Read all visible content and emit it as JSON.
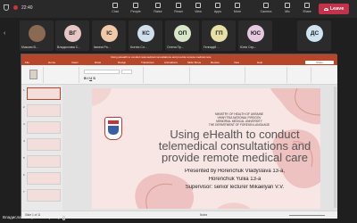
{
  "meeting": {
    "time": "22:40",
    "leave_label": "Leave",
    "toolbar": [
      {
        "label": "Chat",
        "icon": "chat-icon"
      },
      {
        "label": "People",
        "icon": "people-icon"
      },
      {
        "label": "Raise",
        "icon": "raise-hand-icon"
      },
      {
        "label": "React",
        "icon": "react-icon"
      },
      {
        "label": "View",
        "icon": "view-icon"
      },
      {
        "label": "Apps",
        "icon": "apps-icon"
      },
      {
        "label": "More",
        "icon": "more-icon"
      },
      {
        "label": "Camera",
        "icon": "camera-icon"
      },
      {
        "label": "Mic",
        "icon": "mic-icon"
      },
      {
        "label": "Share",
        "icon": "share-icon"
      }
    ]
  },
  "participants": [
    {
      "initials": "",
      "name": "Максим В...",
      "color": "#8a6a50"
    },
    {
      "initials": "ВГ",
      "name": "Владислава С...",
      "color": "#e7c6c6"
    },
    {
      "initials": "ІС",
      "name": "Іванна Ра...",
      "color": "#f0c9a8"
    },
    {
      "initials": "КС",
      "name": "Ксенія Сл...",
      "color": "#cfe0ec"
    },
    {
      "initials": "ОП",
      "name": "Олена Пр...",
      "color": "#d9e7c9"
    },
    {
      "initials": "ГП",
      "name": "Геннадій ...",
      "color": "#e8e0a6"
    },
    {
      "initials": "ЮС",
      "name": "Юлія Сер...",
      "color": "#e4c9df"
    },
    {
      "initials": "ДС",
      "name": "",
      "color": "#cfe3f0"
    }
  ],
  "ppt": {
    "title": "Using eHealth to conduct telemedical consultations and provide remote medical care",
    "tabs": [
      "File",
      "Home",
      "Insert",
      "Draw",
      "Design",
      "Transitions",
      "Animations",
      "Slide Show",
      "Review",
      "View",
      "Help"
    ],
    "share_label": "Share",
    "status_left": "Slide 1 of 11",
    "status_right": "Notes",
    "thumb_numbers": [
      "1",
      "2",
      "3",
      "4",
      "5",
      "6",
      "7"
    ]
  },
  "slide": {
    "header_lines": [
      "MINISTRY OF HEALTH OF UKRAINE",
      "VINNYTSIA NATIONAL PIROGOV",
      "MEMORIAL MEDICAL UNIVERSITY",
      "THE DEPARTMENT OF FOREIGN LANGUAGE"
    ],
    "title_lines": [
      "Using eHealth to conduct",
      "telemedical consultations and",
      "provide remote medical care"
    ],
    "presenters_1": "Presented by Horenchuk Vladyslava 13-a,",
    "presenters_2": "Horenchuk Yuliia 13-a",
    "supervisor": "Supervisor: senior lecturer Mikaelyan V.V."
  },
  "bottom_caption": "Владислава Сергіївна Горенчук",
  "colors": {
    "ppt_accent": "#b7472a",
    "leave": "#c4314b",
    "slide_bg": "#f7e6e4",
    "blob": "#eec2c0"
  }
}
